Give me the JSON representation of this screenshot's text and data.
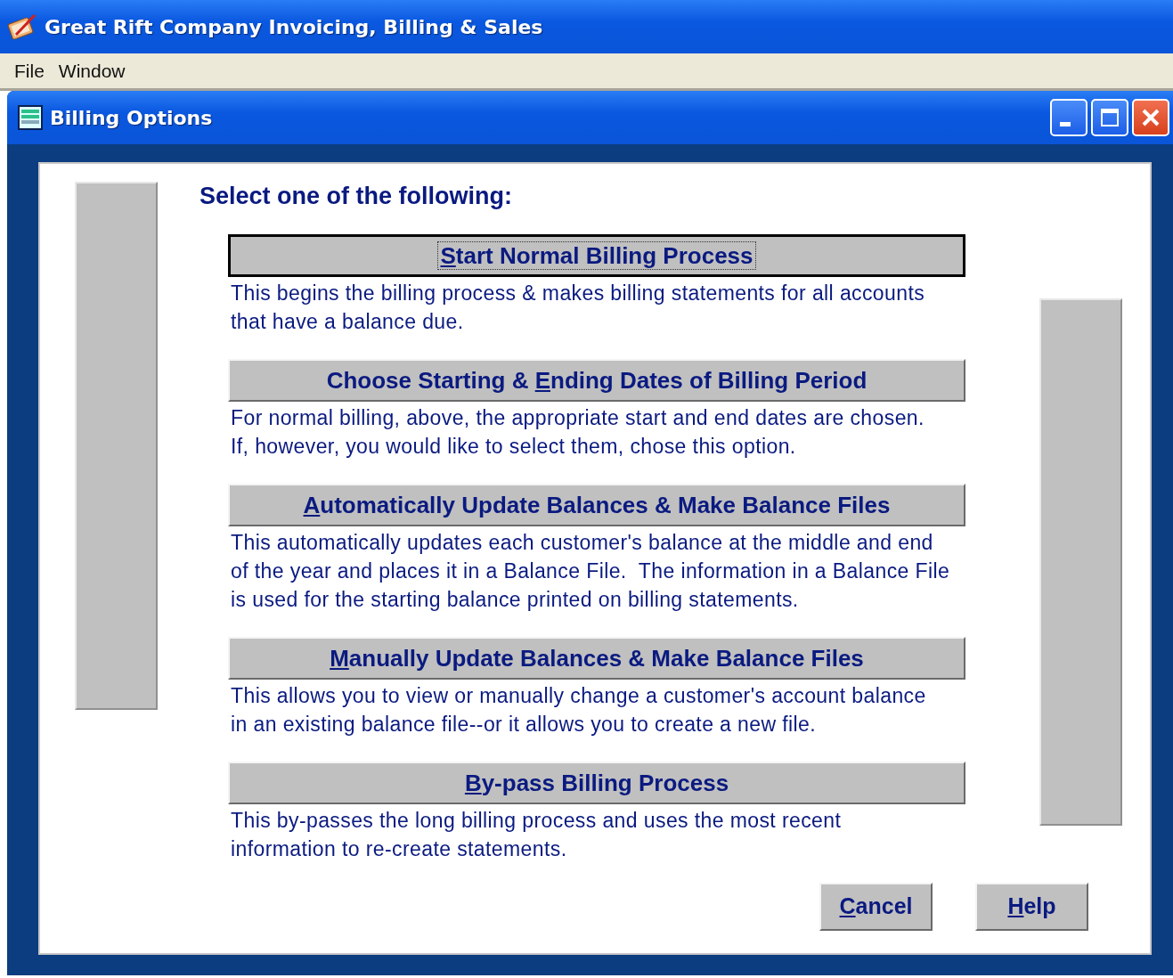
{
  "app": {
    "title": "Great Rift Company Invoicing, Billing & Sales"
  },
  "menu": [
    {
      "label": "File"
    },
    {
      "label": "Window"
    }
  ],
  "window": {
    "title": "Billing Options"
  },
  "heading": "Select one of the following:",
  "options": [
    {
      "key": "S",
      "label_post": "tart Normal Billing Process",
      "default": true,
      "focused": true,
      "description_lines": [
        "This begins the billing process & makes billing statements for all accounts",
        "that have a balance due."
      ]
    },
    {
      "label_pre": "Choose Starting & ",
      "key": "E",
      "label_post": "nding Dates of Billing Period",
      "default": false,
      "focused": false,
      "description_lines": [
        "For normal billing, above, the appropriate start and end dates are chosen.",
        "If, however, you would like to select them, chose this option."
      ]
    },
    {
      "key": "A",
      "label_post": "utomatically Update Balances & Make Balance Files",
      "default": false,
      "focused": false,
      "description_lines": [
        "This automatically updates each customer's balance at the middle and end",
        "of the year and places it in a Balance File.  The information in a Balance File",
        "is used for the starting balance printed on billing statements."
      ]
    },
    {
      "key": "M",
      "label_post": "anually Update Balances & Make Balance Files",
      "default": false,
      "focused": false,
      "description_lines": [
        "This allows you to view or manually change a customer's account balance",
        "in an existing balance file--or it allows you to create a new file."
      ]
    },
    {
      "key": "B",
      "label_post": "y-pass Billing Process",
      "default": false,
      "focused": false,
      "description_lines": [
        "This by-passes the long billing process and uses the most recent",
        "information to re-create statements."
      ]
    }
  ],
  "buttons": [
    {
      "key": "C",
      "label_post": "ancel"
    },
    {
      "key": "H",
      "label_post": "elp"
    }
  ]
}
